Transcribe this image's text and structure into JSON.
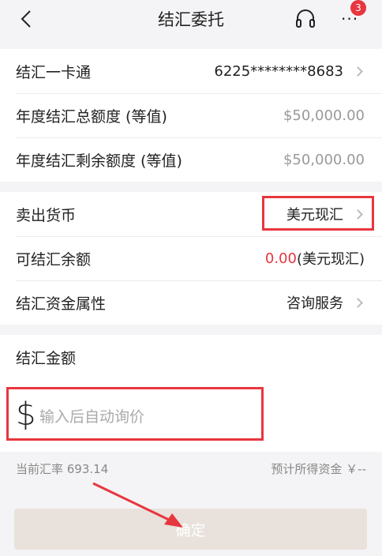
{
  "header": {
    "title": "结汇委托",
    "more_badge": "3",
    "more_label": "···"
  },
  "account": {
    "card_label": "结汇一卡通",
    "card_value": "6225********8683",
    "annual_total_label": "年度结汇总额度 (等值)",
    "annual_total_value": "$50,000.00",
    "annual_remaining_label": "年度结汇剩余额度 (等值)",
    "annual_remaining_value": "$50,000.00"
  },
  "currency": {
    "sell_label": "卖出货币",
    "sell_value": "美元现汇",
    "available_label": "可结汇余额",
    "available_amount": "0.00",
    "available_unit": "(美元现汇)",
    "attribute_label": "结汇资金属性",
    "attribute_value": "咨询服务"
  },
  "amount": {
    "label": "结汇金额",
    "currency_symbol": "$",
    "placeholder": "输入后自动询价"
  },
  "rate": {
    "current_label": "当前汇率 693.14",
    "expected_label": "预计所得资金 ￥--"
  },
  "confirm_label": "确定",
  "colors": {
    "accent_red": "#e8363e",
    "button_disabled": "#e9e2dc"
  }
}
